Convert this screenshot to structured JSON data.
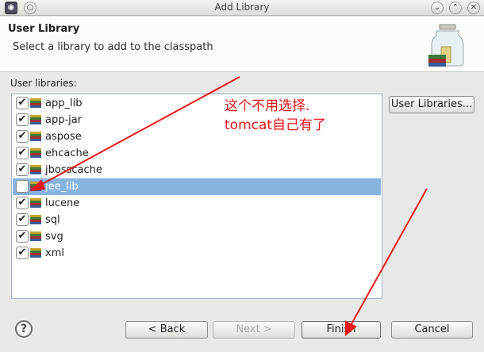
{
  "window": {
    "title": "Add Library",
    "app_icon": "eclipse-icon",
    "menu_icon": "circle-icon",
    "minimize_glyph": "⌄",
    "maximize_glyph": "⌃",
    "close_glyph": "✕"
  },
  "header": {
    "title": "User Library",
    "description": "Select a library to add to the classpath",
    "icon": "library-jar-icon"
  },
  "libraries": {
    "label": "User libraries:",
    "items": [
      {
        "name": "app_lib",
        "checked": true,
        "selected": false
      },
      {
        "name": "app-jar",
        "checked": true,
        "selected": false
      },
      {
        "name": "aspose",
        "checked": true,
        "selected": false
      },
      {
        "name": "ehcache",
        "checked": true,
        "selected": false
      },
      {
        "name": "jbosscache",
        "checked": true,
        "selected": false
      },
      {
        "name": "jee_lib",
        "checked": false,
        "selected": true
      },
      {
        "name": "lucene",
        "checked": true,
        "selected": false
      },
      {
        "name": "sql",
        "checked": true,
        "selected": false
      },
      {
        "name": "svg",
        "checked": true,
        "selected": false
      },
      {
        "name": "xml",
        "checked": true,
        "selected": false
      }
    ]
  },
  "buttons": {
    "user_libraries": "User Libraries...",
    "back": "< Back",
    "next": "Next >",
    "finish": "Finish",
    "cancel": "Cancel",
    "help": "?"
  },
  "annotation": {
    "line1": "这个不用选择.",
    "line2": "tomcat自己有了",
    "color": "#e8151a"
  }
}
